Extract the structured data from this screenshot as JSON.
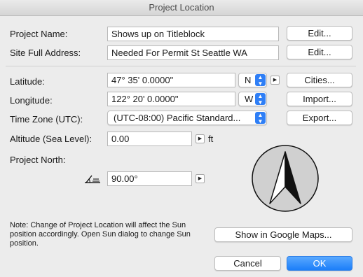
{
  "window": {
    "title": "Project Location"
  },
  "project": {
    "name_label": "Project Name:",
    "name_value": "Shows up on Titleblock",
    "name_edit": "Edit...",
    "address_label": "Site Full Address:",
    "address_value": "Needed For Permit St Seattle WA",
    "address_edit": "Edit..."
  },
  "location": {
    "latitude_label": "Latitude:",
    "latitude_value": "47° 35' 0.0000\"",
    "latitude_dir": "N",
    "cities_button": "Cities...",
    "longitude_label": "Longitude:",
    "longitude_value": "122° 20' 0.0000\"",
    "longitude_dir": "W",
    "import_button": "Import...",
    "timezone_label": "Time Zone (UTC):",
    "timezone_value": "(UTC-08:00) Pacific Standard...",
    "export_button": "Export...",
    "altitude_label": "Altitude (Sea Level):",
    "altitude_value": "0.00",
    "altitude_unit": "ft",
    "north_label": "Project North:",
    "north_value": "90.00°"
  },
  "note": {
    "line1": "Note: Change of Project Location will affect the Sun",
    "line2": "position accordingly. Open Sun dialog to change Sun",
    "line3": "position."
  },
  "buttons": {
    "google_maps": "Show in Google Maps...",
    "cancel": "Cancel",
    "ok": "OK"
  },
  "colors": {
    "accent": "#1b7ef9",
    "background": "#ececec"
  }
}
